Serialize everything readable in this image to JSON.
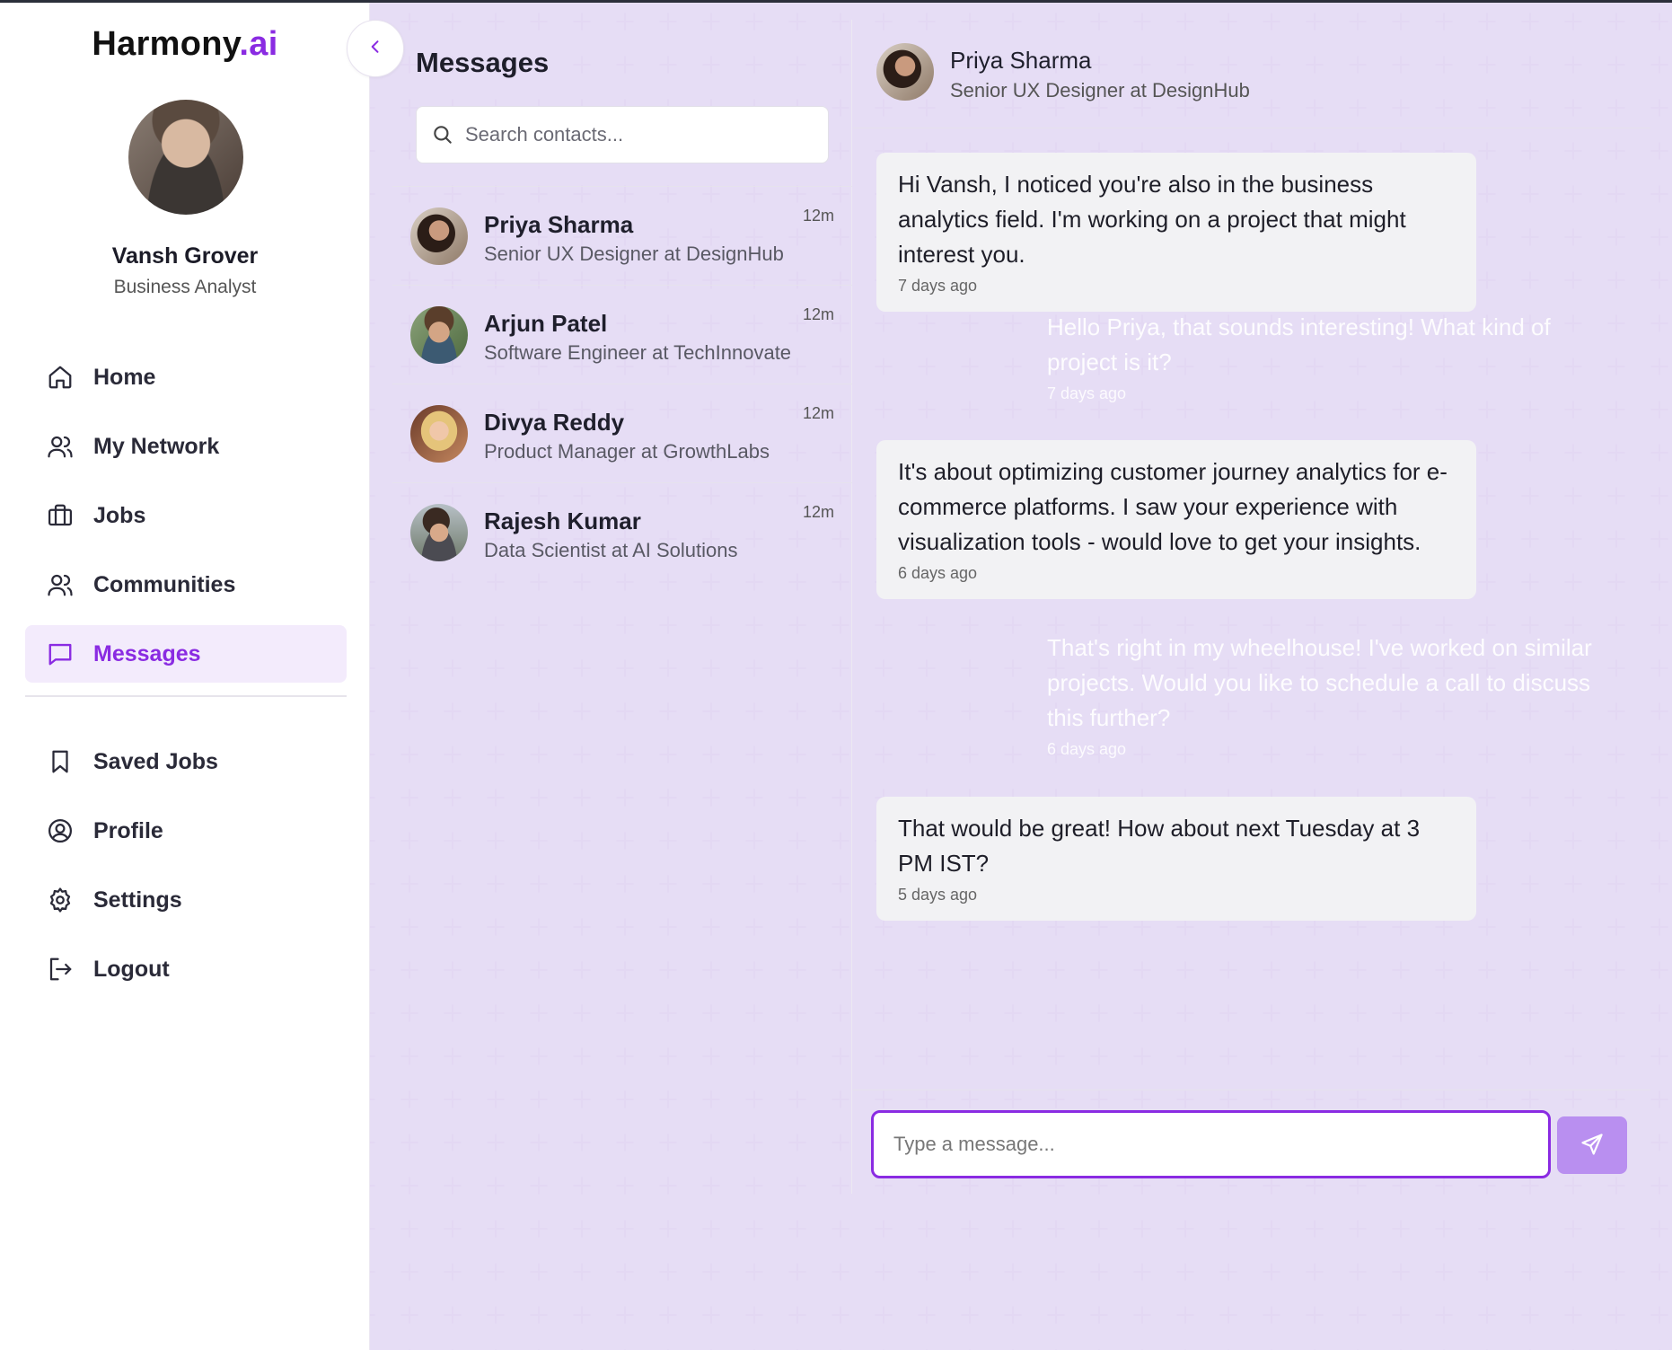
{
  "app": {
    "brand_main": "Harmony",
    "brand_accent": ".ai",
    "accent_color": "#8a2be2"
  },
  "user": {
    "name": "Vansh Grover",
    "role": "Business Analyst"
  },
  "nav": {
    "primary": [
      {
        "label": "Home",
        "icon": "home-icon"
      },
      {
        "label": "My Network",
        "icon": "users-icon"
      },
      {
        "label": "Jobs",
        "icon": "briefcase-icon"
      },
      {
        "label": "Communities",
        "icon": "users-icon"
      },
      {
        "label": "Messages",
        "icon": "message-icon",
        "active": true
      }
    ],
    "secondary": [
      {
        "label": "Saved Jobs",
        "icon": "bookmark-icon"
      },
      {
        "label": "Profile",
        "icon": "user-circle-icon"
      },
      {
        "label": "Settings",
        "icon": "gear-icon"
      },
      {
        "label": "Logout",
        "icon": "logout-icon"
      }
    ]
  },
  "messages_panel": {
    "title": "Messages",
    "search_placeholder": "Search contacts...",
    "contacts": [
      {
        "name": "Priya Sharma",
        "role": "Senior UX Designer at DesignHub",
        "time": "12m"
      },
      {
        "name": "Arjun Patel",
        "role": "Software Engineer at TechInnovate",
        "time": "12m"
      },
      {
        "name": "Divya Reddy",
        "role": "Product Manager at GrowthLabs",
        "time": "12m"
      },
      {
        "name": "Rajesh Kumar",
        "role": "Data Scientist at AI Solutions",
        "time": "12m"
      }
    ]
  },
  "chat": {
    "contact_name": "Priya Sharma",
    "contact_role": "Senior UX Designer at DesignHub",
    "messages": [
      {
        "from": "Priya Sharma",
        "text": "Hi Vansh, I noticed you're also in the business analytics field. I'm working on a project that might interest you.",
        "time": "7 days ago"
      },
      {
        "from": "Vansh Grover",
        "text": "Hello Priya, that sounds interesting! What kind of project is it?",
        "time": "7 days ago"
      },
      {
        "from": "Priya Sharma",
        "text": "It's about optimizing customer journey analytics for e-commerce platforms. I saw your experience with visualization tools - would love to get your insights.",
        "time": "6 days ago"
      },
      {
        "from": "Vansh Grover",
        "text": "That's right in my wheelhouse! I've worked on similar projects. Would you like to schedule a call to discuss this further?",
        "time": "6 days ago"
      },
      {
        "from": "Priya Sharma",
        "text": "That would be great! How about next Tuesday at 3 PM IST?",
        "time": "5 days ago"
      }
    ],
    "input_placeholder": "Type a message..."
  }
}
